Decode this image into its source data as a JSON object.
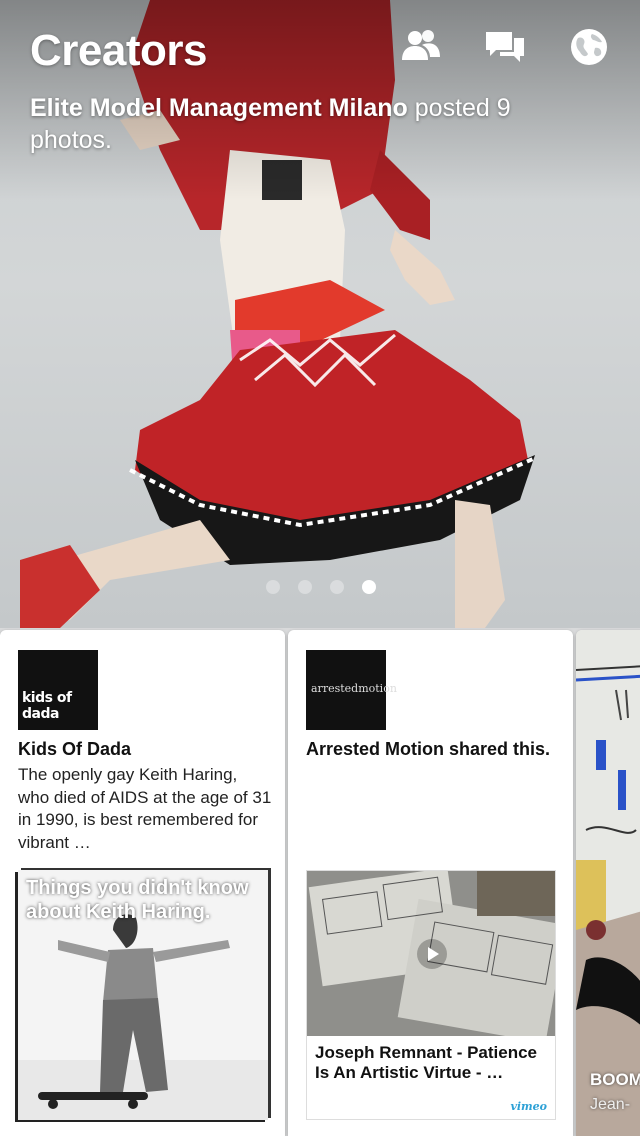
{
  "header": {
    "title": "Creators",
    "icons": [
      "friends-icon",
      "messages-icon",
      "globe-icon"
    ]
  },
  "hero": {
    "author": "Elite Model Management Milano",
    "caption_rest": " posted 9 photos.",
    "pager": {
      "count": 4,
      "active_index": 3
    }
  },
  "cards": [
    {
      "avatar_text": "kids of dada",
      "title": "Kids Of Dada",
      "text": "The openly gay Keith Haring, who died of AIDS at the age of 31 in 1990, is best remembered for vibrant …",
      "media_overlay": "Things you didn't know about Keith Haring."
    },
    {
      "avatar_text": "arrestedmotion",
      "title": "Arrested Motion shared this.",
      "video_title": "Joseph Remnant - Patience Is An Artistic Virtue - …",
      "video_brand": "vimeo"
    },
    {
      "title_partial": "BOOM",
      "sub_partial": "Jean-"
    }
  ],
  "colors": {
    "dress_red": "#b51f22",
    "vimeo_blue": "#2da1d6",
    "card_bg": "#ffffff"
  }
}
